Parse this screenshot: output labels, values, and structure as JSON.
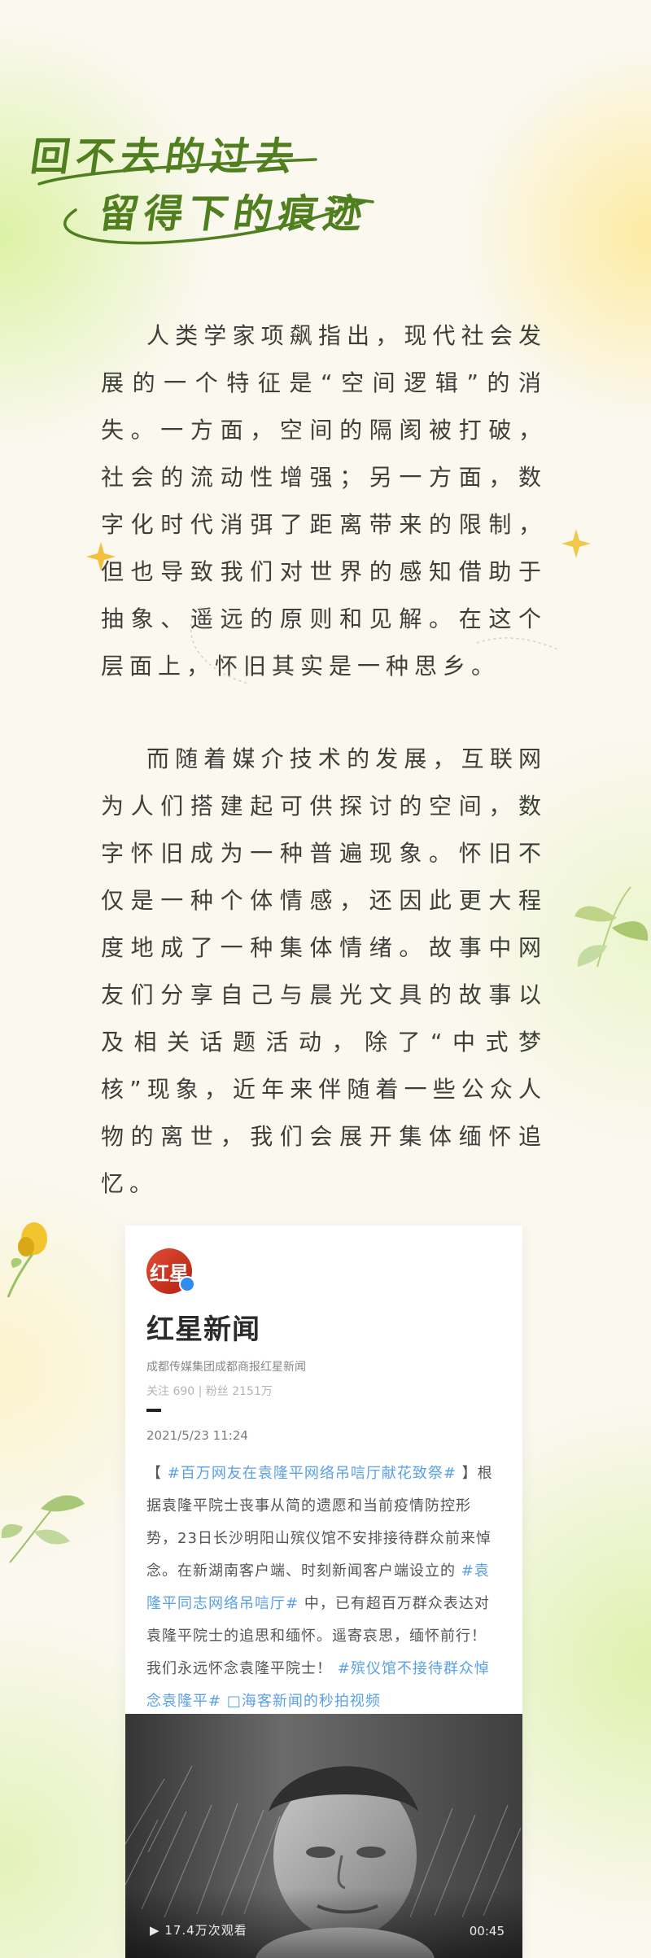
{
  "hero": {
    "line1": "回不去的过去",
    "line2": "留得下的痕迹"
  },
  "article": {
    "paragraph1": "人类学家项飙指出，现代社会发展的一个特征是“空间逻辑”的消失。一方面，空间的隔阂被打破，社会的流动性增强；另一方面，数字化时代消弭了距离带来的限制，但也导致我们对世界的感知借助于抽象、遥远的原则和见解。在这个层面上，怀旧其实是一种思乡。",
    "paragraph2": "而随着媒介技术的发展，互联网为人们搭建起可供探讨的空间，数字怀旧成为一种普遍现象。怀旧不仅是一种个体情感，还因此更大程度地成了一种集体情绪。故事中网友们分享自己与晨光文具的故事以及相关话题活动，除了“中式梦核”现象，近年来伴随着一些公众人物的离世，我们会展开集体缅怀追忆。"
  },
  "card": {
    "logo_text": "红星",
    "name": "红星新闻",
    "sub": "成都传媒集团成都商报红星新闻",
    "stats": "关注 690 | 粉丝 2151万",
    "date": "2021/5/23 11:24",
    "body_prefix": "【",
    "body_tag1": "#百万网友在袁隆平网络吊唁厅献花致祭#",
    "body_text1": "】根据袁隆平院士丧事从简的遗愿和当前疫情防控形势，23日长沙明阳山殡仪馆不安排接待群众前来悼念。在新湖南客户端、时刻新闻客户端设立的",
    "body_tag2": "#袁隆平同志网络吊唁厅#",
    "body_text2": "中，已有超百万群众表达对袁隆平院士的追思和缅怀。遥寄哀思，缅怀前行！我们永远怀念袁隆平院士！",
    "body_tag3": "#殡仪馆不接待群众悼念袁隆平#",
    "body_tag4": "□海客新闻的秒拍视频",
    "video_views": "17.4万次观看",
    "video_duration": "00:45"
  },
  "colors": {
    "title_green": "#4f7f1f",
    "tag_blue": "#5aa0e7"
  }
}
